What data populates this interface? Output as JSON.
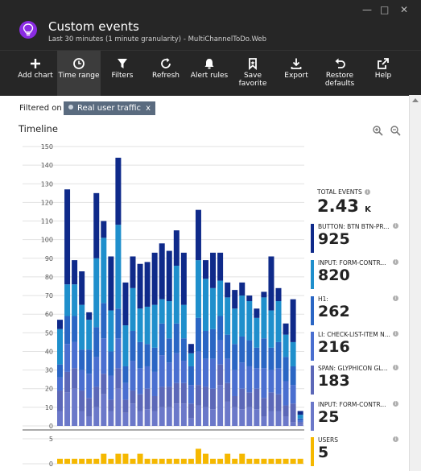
{
  "header": {
    "title": "Custom events",
    "subtitle": "Last 30 minutes (1 minute granularity) - MultiChannelToDo.Web"
  },
  "toolbar": [
    {
      "label": "Add chart",
      "icon": "plus-icon"
    },
    {
      "label": "Time range",
      "icon": "clock-icon",
      "active": true
    },
    {
      "label": "Filters",
      "icon": "funnel-icon"
    },
    {
      "label": "Refresh",
      "icon": "refresh-icon"
    },
    {
      "label": "Alert rules",
      "icon": "bell-icon"
    },
    {
      "label": "Save",
      "label2": "favorite",
      "icon": "bookmark-icon"
    },
    {
      "label": "Export",
      "icon": "download-icon"
    },
    {
      "label": "Restore",
      "label2": "defaults",
      "icon": "undo-icon"
    },
    {
      "label": "Help",
      "icon": "external-link-icon"
    }
  ],
  "filter": {
    "label": "Filtered on",
    "chip": "Real user traffic",
    "chip_close": "x"
  },
  "timeline": {
    "title": "Timeline"
  },
  "totals": {
    "label": "TOTAL EVENTS",
    "value": "2.43",
    "unit": "K"
  },
  "metrics": [
    {
      "label": "BUTTON: BTN BTN-PR...",
      "value": "925",
      "color": "#0f2a8a"
    },
    {
      "label": "INPUT: FORM-CONTR...",
      "value": "820",
      "color": "#1f8fcc"
    },
    {
      "label": "H1:",
      "value": "262",
      "color": "#2a66c4"
    },
    {
      "label": "LI: CHECK-LIST-ITEM N...",
      "value": "216",
      "color": "#4a6fd0"
    },
    {
      "label": "SPAN: GLYPHICON GL...",
      "value": "183",
      "color": "#5c68b8"
    },
    {
      "label": "INPUT: FORM-CONTR...",
      "value": "25",
      "color": "#6b78c9"
    },
    {
      "label": "USERS",
      "value": "5",
      "color": "#f5b800"
    }
  ],
  "chart_data": [
    {
      "type": "bar",
      "stacked": true,
      "ylim": [
        0,
        150
      ],
      "yticks": [
        0,
        10,
        20,
        30,
        40,
        50,
        60,
        70,
        80,
        90,
        100,
        110,
        120,
        130,
        140,
        150
      ],
      "grid": true,
      "series": [
        {
          "color": "#6b78c9",
          "values": [
            8,
            18,
            20,
            8,
            5,
            10,
            17,
            8,
            20,
            7,
            12,
            8,
            9,
            8,
            10,
            10,
            12,
            12,
            4,
            11,
            10,
            9,
            22,
            13,
            10,
            9,
            10,
            9,
            5,
            8,
            8,
            5,
            2,
            1
          ]
        },
        {
          "color": "#5c68b8",
          "values": [
            11,
            11,
            11,
            11,
            10,
            11,
            11,
            6,
            11,
            7,
            7,
            9,
            11,
            8,
            11,
            11,
            11,
            11,
            8,
            11,
            11,
            11,
            11,
            10,
            6,
            11,
            8,
            11,
            10,
            10,
            9,
            6,
            10,
            1
          ]
        },
        {
          "color": "#4a6fd0",
          "values": [
            7,
            15,
            14,
            11,
            13,
            16,
            19,
            13,
            16,
            9,
            16,
            14,
            12,
            13,
            17,
            13,
            16,
            12,
            10,
            18,
            15,
            16,
            13,
            13,
            14,
            14,
            14,
            11,
            16,
            12,
            14,
            13,
            10,
            1
          ]
        },
        {
          "color": "#2a66c4",
          "values": [
            7,
            15,
            14,
            11,
            13,
            16,
            19,
            13,
            16,
            9,
            16,
            14,
            12,
            13,
            17,
            13,
            16,
            12,
            10,
            18,
            15,
            16,
            13,
            13,
            14,
            14,
            14,
            11,
            16,
            12,
            14,
            13,
            10,
            1
          ]
        },
        {
          "color": "#1f8fcc",
          "values": [
            19,
            17,
            17,
            24,
            16,
            37,
            35,
            22,
            45,
            22,
            23,
            18,
            20,
            23,
            13,
            20,
            31,
            18,
            7,
            31,
            28,
            22,
            19,
            20,
            19,
            22,
            21,
            16,
            22,
            20,
            22,
            12,
            13,
            2
          ]
        },
        {
          "color": "#0f2a8a",
          "values": [
            5,
            51,
            13,
            18,
            4,
            35,
            9,
            29,
            36,
            23,
            17,
            24,
            24,
            28,
            30,
            27,
            19,
            28,
            5,
            27,
            10,
            19,
            15,
            8,
            10,
            7,
            3,
            5,
            3,
            29,
            7,
            6,
            23,
            2
          ]
        }
      ]
    },
    {
      "type": "bar",
      "ylim": [
        0,
        5
      ],
      "yticks": [
        0,
        5
      ],
      "series": [
        {
          "name": "USERS",
          "color": "#f5b800",
          "values": [
            1,
            1,
            1,
            1,
            1,
            1,
            2,
            1,
            2,
            2,
            1,
            2,
            1,
            1,
            1,
            1,
            1,
            1,
            1,
            3,
            2,
            1,
            1,
            2,
            1,
            2,
            1,
            1,
            1,
            1,
            1,
            1,
            1,
            1
          ]
        }
      ]
    }
  ]
}
